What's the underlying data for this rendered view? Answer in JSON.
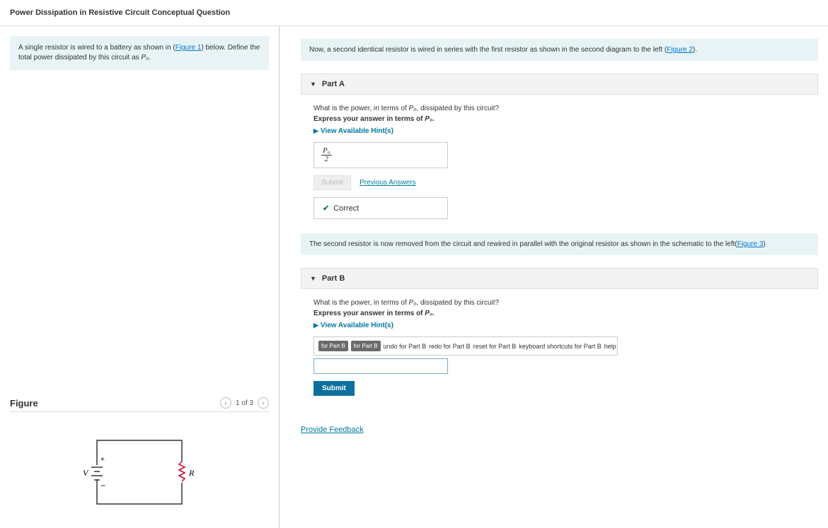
{
  "header": {
    "title": "Power Dissipation in Resistive Circuit Conceptual Question"
  },
  "left": {
    "intro_pre": "A single resistor is wired to a battery as shown in (",
    "intro_link": "Figure 1",
    "intro_post": ") below. Define the total power dissipated by this circuit as ",
    "intro_var": "P₀",
    "intro_end": ".",
    "figure_label": "Figure",
    "pager": "1 of 3",
    "circuit": {
      "V": "V",
      "R": "R",
      "plus": "+",
      "minus": "−"
    }
  },
  "right": {
    "contextA_pre": "Now, a second identical resistor is wired in series with the first resistor as shown in the second diagram to the left (",
    "contextA_link": "Figure 2",
    "contextA_post": ").",
    "partA": {
      "label": "Part A",
      "q1_pre": "What is the power, in terms of ",
      "q1_var": "P₀",
      "q1_post": ", dissipated by this circuit?",
      "q2_pre": "Express your answer in terms of ",
      "q2_var": "P₀",
      "q2_post": ".",
      "hints": "View Available Hint(s)",
      "ans_top": "P₀",
      "ans_bot": "2",
      "submit": "Submit",
      "prev": "Previous Answers",
      "correct": "Correct"
    },
    "contextB_pre": "The second resistor is now removed from the circuit and rewired in parallel with the original resistor as shown in the schematic to the left(",
    "contextB_link": "Figure 3",
    "contextB_post": ")",
    "partB": {
      "label": "Part B",
      "q1_pre": "What is the power, in terms of ",
      "q1_var": "P₀",
      "q1_post": ", dissipated by this circuit?",
      "q2_pre": "Express your answer in terms of ",
      "q2_var": "P₀",
      "q2_post": ".",
      "hints": "View Available Hint(s)",
      "toolbar": {
        "b1": "for Part B",
        "b2": "for Part B",
        "undo": "undo for Part B",
        "redo": "redo for Part B",
        "reset": "reset for Part B",
        "kbd": "keyboard shortcuts for Part B",
        "help": "help for Part B"
      },
      "submit": "Submit"
    },
    "feedback": "Provide Feedback"
  }
}
